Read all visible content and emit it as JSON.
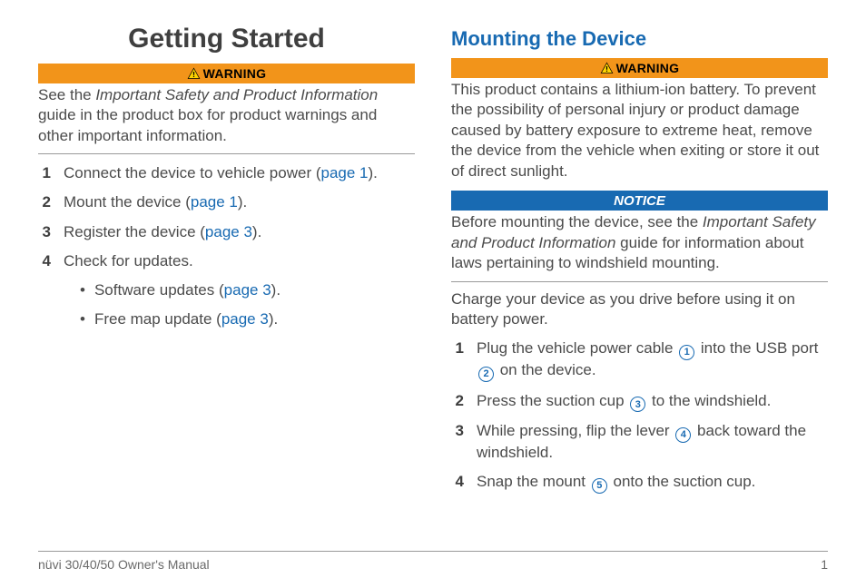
{
  "footer": {
    "left": "nüvi 30/40/50 Owner's Manual",
    "right": "1"
  },
  "left": {
    "title": "Getting Started",
    "warning_label": "WARNING",
    "warning_text_1": "See the ",
    "warning_text_em": "Important Safety and Product Information",
    "warning_text_2": " guide in the product box for product warnings and other important information.",
    "steps": [
      {
        "n": "1",
        "pre": "Connect the device to vehicle power (",
        "link": "page 1",
        "post": ")."
      },
      {
        "n": "2",
        "pre": "Mount the device (",
        "link": "page 1",
        "post": ")."
      },
      {
        "n": "3",
        "pre": "Register the device (",
        "link": "page 3",
        "post": ")."
      },
      {
        "n": "4",
        "pre": "Check for updates.",
        "link": "",
        "post": ""
      }
    ],
    "substeps": [
      {
        "pre": "Software updates (",
        "link": "page 3",
        "post": ")."
      },
      {
        "pre": "Free map update (",
        "link": "page 3",
        "post": ")."
      }
    ]
  },
  "right": {
    "title": "Mounting the Device",
    "warning_label": "WARNING",
    "warning_text": "This product contains a lithium-ion battery. To prevent the possibility of personal injury or product damage caused by battery exposure to extreme heat, remove the device from the vehicle when exiting or store it out of direct sunlight.",
    "notice_label": "NOTICE",
    "notice_text_1": "Before mounting the device, see the ",
    "notice_text_em": "Important Safety and Product Information",
    "notice_text_2": " guide for information about laws pertaining to windshield mounting.",
    "charge_text": "Charge your device as you drive before using it on battery power.",
    "steps": [
      {
        "n": "1",
        "parts": [
          "Plug the vehicle power cable ",
          "①",
          " into the USB port ",
          "②",
          " on the device."
        ]
      },
      {
        "n": "2",
        "parts": [
          "Press the suction cup ",
          "③",
          " to the windshield."
        ]
      },
      {
        "n": "3",
        "parts": [
          "While pressing, flip the lever ",
          "④",
          " back toward the windshield."
        ]
      },
      {
        "n": "4",
        "parts": [
          "Snap the mount ",
          "⑤",
          " onto the suction cup."
        ]
      }
    ],
    "callouts": {
      "①": "1",
      "②": "2",
      "③": "3",
      "④": "4",
      "⑤": "5"
    }
  }
}
